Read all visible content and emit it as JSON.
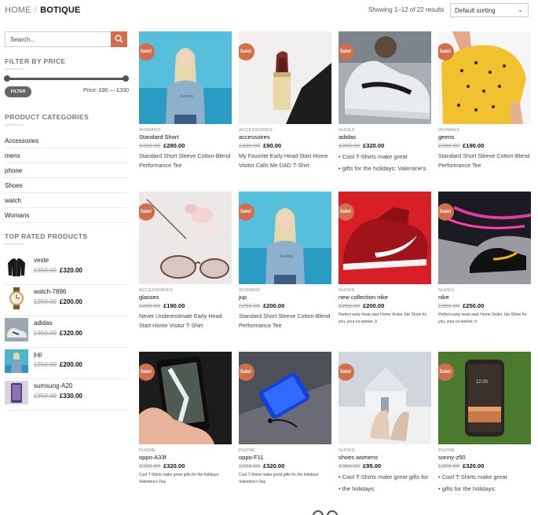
{
  "breadcrumb": {
    "home": "HOME",
    "separator": "/",
    "current": "BOTIQUE"
  },
  "results_text": "Showing 1–12 of 22 results",
  "sort": {
    "selected": "Default sorting"
  },
  "search": {
    "placeholder": "Search..."
  },
  "filter": {
    "title": "FILTER BY PRICE",
    "button": "FILTER",
    "price_text": "Price: £90 — £330",
    "range_fraction": [
      0.0,
      1.0
    ]
  },
  "categories": {
    "title": "PRODUCT CATEGORIES",
    "items": [
      "Accessories",
      "mens",
      "phone",
      "Shoes",
      "watch",
      "Womans"
    ]
  },
  "top_rated": {
    "title": "TOP RATED PRODUCTS",
    "items": [
      {
        "name": "veste",
        "old": "£350.00",
        "new": "£320.00",
        "icon": "jacket"
      },
      {
        "name": "watch-7896",
        "old": "£250.00",
        "new": "£200.00",
        "icon": "watch"
      },
      {
        "name": "adidas",
        "old": "£350.00",
        "new": "£320.00",
        "icon": "shoe"
      },
      {
        "name": "jup",
        "old": "£250.00",
        "new": "£200.00",
        "icon": "woman"
      },
      {
        "name": "sumsung-A20",
        "old": "£350.00",
        "new": "£330.00",
        "icon": "phone"
      }
    ]
  },
  "sale_badge": "Sale!",
  "products": [
    {
      "cat": "WOMANS",
      "name": "Standard Short",
      "old": "£300.00",
      "new": "£280.00",
      "desc": "Standard Short Sleeve Cotton-Blend Performance Tee",
      "style": "text"
    },
    {
      "cat": "ACCESSORIES",
      "name": "accessoires",
      "old": "£100.00",
      "new": "£90.00",
      "desc": "My Favorite Early Head Start Home Visitor Calls Me DAD T-Shirt",
      "style": "text"
    },
    {
      "cat": "SHOES",
      "name": "adidas",
      "old": "£350.00",
      "new": "£320.00",
      "bullets": [
        "Cool T-Shirts make great",
        "gifts for the holidays: Valentine's"
      ],
      "style": "bullets"
    },
    {
      "cat": "WOMANS",
      "name": "geens",
      "old": "£200.00",
      "new": "£190.00",
      "desc": "Standard Short Sleeve Cotton-Blend Performance Tee",
      "style": "text"
    },
    {
      "cat": "ACCESSORIES",
      "name": "glasses",
      "old": "£200.00",
      "new": "£190.00",
      "desc": "Never Underestimate Early Head Start Home Visitor T-Shirt",
      "style": "text"
    },
    {
      "cat": "WOMANS",
      "name": "jup",
      "old": "£250.00",
      "new": "£200.00",
      "desc": "Standard Short Sleeve Cotton-Blend Performance Tee",
      "style": "text"
    },
    {
      "cat": "SHOES",
      "name": "new collection nike",
      "old": "£250.00",
      "new": "£200.00",
      "desc": "Perfect early head start Home Visitor Job Shirts for you, your co-worker, b",
      "style": "small"
    },
    {
      "cat": "SHOES",
      "name": "nike",
      "old": "£350.00",
      "new": "£250.00",
      "desc": "Perfect early head start Home Visitor Job Shirts for you, your co-worker, b",
      "style": "small"
    },
    {
      "cat": "PHONE",
      "name": "oppo-A33f",
      "old": "£350.00",
      "new": "£320.00",
      "desc": "Cool T-Shirts make great gifts for the holidays: Valentine's Day",
      "style": "small"
    },
    {
      "cat": "PHONE",
      "name": "oppo-F11",
      "old": "£350.00",
      "new": "£320.00",
      "desc": "Cool T-Shirts make great gifts for the holidays: Valentine's Day",
      "style": "small"
    },
    {
      "cat": "SHOES",
      "name": "shoes womens",
      "old": "£350.00",
      "new": "£95.00",
      "bullets": [
        "Cool T-Shirts make great gifts for",
        "the holidays:"
      ],
      "style": "bullets"
    },
    {
      "cat": "PHONE",
      "name": "sonny-z50",
      "old": "£350.00",
      "new": "£320.00",
      "bullets": [
        "Cool T-Shirts make great",
        "gifts for the holidays:"
      ],
      "style": "bullets"
    }
  ],
  "colors": {
    "accent": "#d26e4b",
    "dark": "#555555"
  }
}
